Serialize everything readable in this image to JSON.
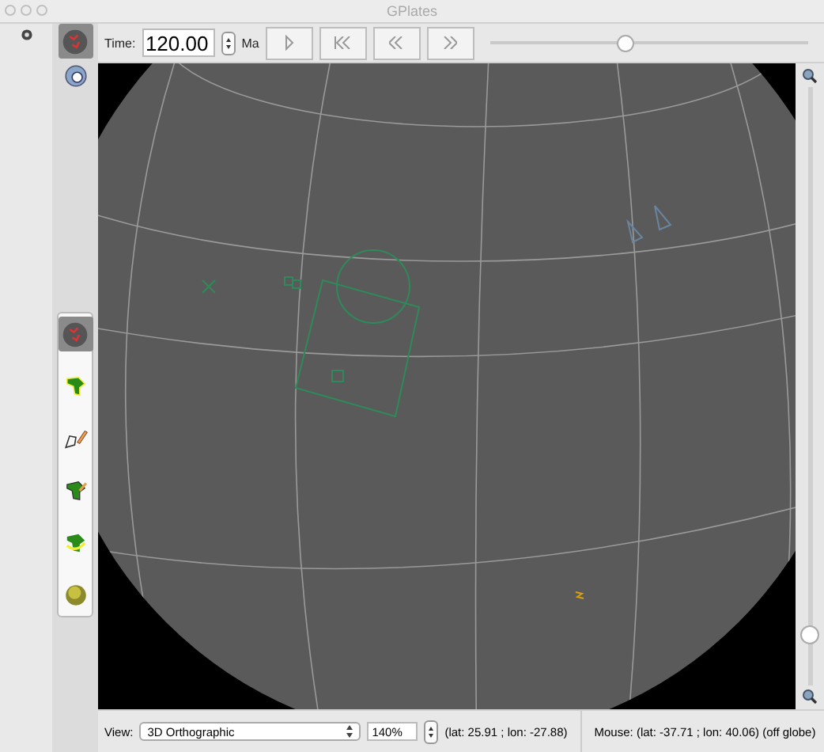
{
  "window": {
    "title": "GPlates"
  },
  "canvas_tools": [
    {
      "kind": "globe",
      "selected": true
    },
    {
      "kind": "zoom",
      "selected": false
    }
  ],
  "toolbar": {
    "time_label": "Time:",
    "time_value": "120.00",
    "time_unit": "Ma",
    "animation_slider": {
      "level": 0.42
    }
  },
  "tool_palette": [
    {
      "kind": "globe",
      "selected": true
    },
    {
      "kind": "plate",
      "selected": false
    },
    {
      "kind": "digitise",
      "selected": false
    },
    {
      "kind": "edit",
      "selected": false
    },
    {
      "kind": "rotate",
      "selected": false
    },
    {
      "kind": "sphere",
      "selected": false
    }
  ],
  "zoom_slider": {
    "level": 0.07
  },
  "status_bar": {
    "view_label": "View:",
    "view_value": "3D Orthographic",
    "zoom_value": "140%",
    "camera": "(lat: 25.91 ; lon: -27.88)",
    "mouse": "Mouse: (lat: -37.71 ; lon: 40.06) (off globe)"
  }
}
